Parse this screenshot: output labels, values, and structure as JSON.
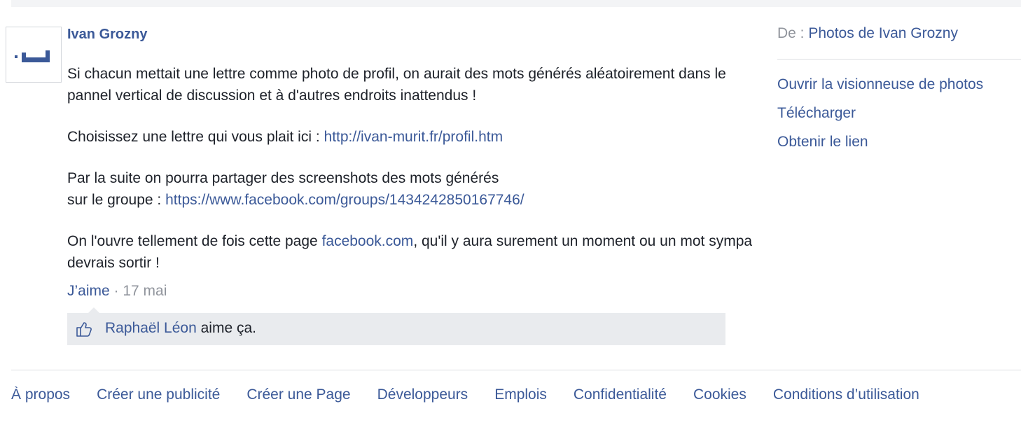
{
  "post": {
    "author": "Ivan Grozny",
    "para1": "Si chacun mettait une lettre comme photo de profil, on aurait  des mots générés aléatoirement dans le pannel vertical de discussion et à d'autres endroits inattendus !",
    "para2_prefix": "Choisissez une lettre qui vous plait  ici : ",
    "para2_link": "http://ivan-murit.fr/profil.htm",
    "para3_line1": "Par la suite on pourra partager des screenshots des mots générés",
    "para3_prefix": "sur le groupe : ",
    "para3_link": "https://www.facebook.com/groups/1434242850167746/",
    "para4_prefix": "On l'ouvre tellement de fois cette page ",
    "para4_link": "facebook.com",
    "para4_suffix": ", qu'il y aura surement un moment ou un mot sympa devrais sortir !",
    "like_label": "J’aime",
    "separator": " · ",
    "date": "17 mai",
    "likes": {
      "name": "Raphaël Léon",
      "suffix": " aime ça."
    }
  },
  "sidebar": {
    "from_label": "De : ",
    "from_link": "Photos de Ivan Grozny",
    "links": [
      "Ouvrir la visionneuse de photos",
      "Télécharger",
      "Obtenir le lien"
    ]
  },
  "footer": {
    "links": [
      "À propos",
      "Créer une publicité",
      "Créer une Page",
      "Développeurs",
      "Emplois",
      "Confidentialité",
      "Cookies",
      "Conditions d’utilisation"
    ]
  },
  "colors": {
    "link": "#3b5998",
    "muted": "#90949c",
    "likes_bg": "#e9ebee"
  },
  "icons": [
    "avatar-letter-image",
    "like-thumb-icon"
  ]
}
